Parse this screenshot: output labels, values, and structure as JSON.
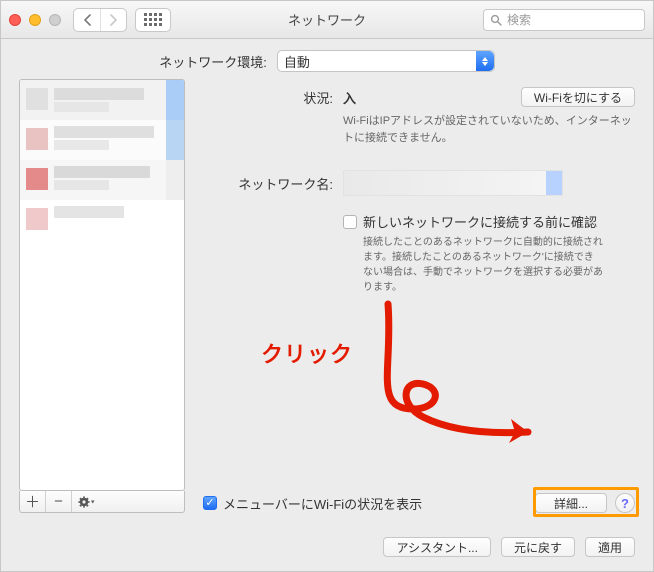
{
  "window": {
    "title": "ネットワーク"
  },
  "search": {
    "placeholder": "検索"
  },
  "location": {
    "label": "ネットワーク環境:",
    "value": "自動"
  },
  "status": {
    "label": "状況:",
    "value": "入",
    "toggle_btn": "Wi-Fiを切にする",
    "desc": "Wi-FiはIPアドレスが設定されていないため、インターネットに接続できません。"
  },
  "network_name": {
    "label": "ネットワーク名:",
    "confirm_label": "新しいネットワークに接続する前に確認",
    "confirm_desc": "接続したことのあるネットワークに自動的に接続されます。接続したことのあるネットワーク'に接続できない場合は、手動でネットワークを選択する必要があります。"
  },
  "menubar_checkbox": "メニューバーにWi-Fiの状況を表示",
  "advanced_btn": "詳細...",
  "annotation": "クリック",
  "footer": {
    "assistant": "アシスタント...",
    "revert": "元に戻す",
    "apply": "適用"
  },
  "help": "?"
}
